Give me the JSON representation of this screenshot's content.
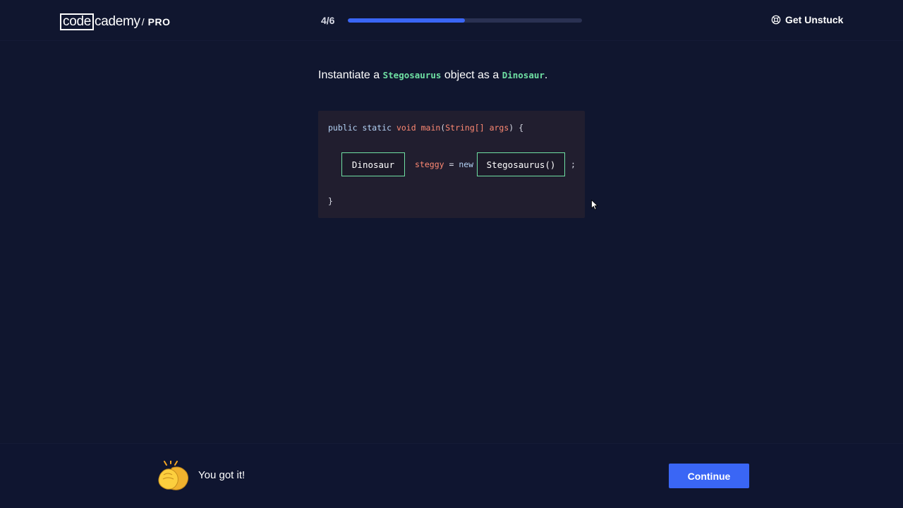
{
  "header": {
    "logo": {
      "boxed": "code",
      "rest": "cademy",
      "slash": "/",
      "tier": "PRO"
    },
    "progress": {
      "label": "4/6",
      "fraction": 0.5
    },
    "help_label": "Get Unstuck"
  },
  "prompt": {
    "before": "Instantiate a ",
    "class_name": "Stegosaurus",
    "middle": " object as a ",
    "type_name": "Dinosaur",
    "after": "."
  },
  "code": {
    "line1": {
      "kw1": "public static",
      "kw2": "void",
      "fn": "main",
      "open": "(",
      "type": "String[]",
      "param": "args",
      "close": ") {"
    },
    "line2": {
      "ident": "steggy",
      "eq": " = ",
      "kw_new": "new",
      "semicolon": ";"
    },
    "slot1": "Dinosaur",
    "slot2": "Stegosaurus()",
    "line3": "}"
  },
  "footer": {
    "feedback": "You got it!",
    "continue_label": "Continue"
  },
  "colors": {
    "background": "#10162f",
    "accent": "#3a66f5",
    "code_green": "#6fe0a3",
    "code_bg": "#211e2f"
  }
}
